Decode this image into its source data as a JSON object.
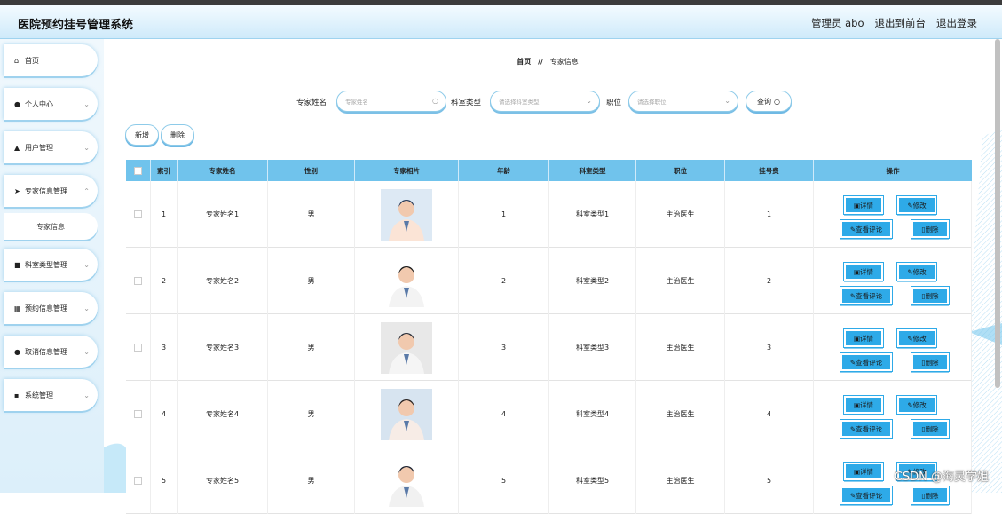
{
  "header": {
    "title": "医院预约挂号管理系统",
    "admin_label": "管理员 abo",
    "to_front": "退出到前台",
    "logout": "退出登录"
  },
  "sidebar": {
    "items": [
      {
        "label": "首页",
        "icon": "home-icon"
      },
      {
        "label": "个人中心",
        "icon": "user-icon"
      },
      {
        "label": "用户管理",
        "icon": "thumb-icon"
      },
      {
        "label": "专家信息管理",
        "icon": "send-icon"
      },
      {
        "label": "专家信息",
        "icon": ""
      },
      {
        "label": "科室类型管理",
        "icon": "monitor-icon"
      },
      {
        "label": "预约信息管理",
        "icon": "grid-icon"
      },
      {
        "label": "取消信息管理",
        "icon": "pin-icon"
      },
      {
        "label": "系统管理",
        "icon": "apps-icon"
      }
    ]
  },
  "breadcrumb": {
    "home": "首页",
    "sep": "//",
    "current": "专家信息"
  },
  "search": {
    "name_label": "专家姓名",
    "name_placeholder": "专家姓名",
    "dept_label": "科室类型",
    "dept_placeholder": "请选择科室类型",
    "pos_label": "职位",
    "pos_placeholder": "请选择职位",
    "query_button": "查询"
  },
  "toolbar": {
    "add_label": "新增",
    "delete_label": "删除"
  },
  "table": {
    "headers": [
      "",
      "索引",
      "专家姓名",
      "性别",
      "专家相片",
      "年龄",
      "科室类型",
      "职位",
      "挂号费",
      "操作"
    ],
    "rows": [
      {
        "index": "1",
        "name": "专家姓名1",
        "gender": "男",
        "age": "1",
        "dept": "科室类型1",
        "position": "主治医生",
        "fee": "1"
      },
      {
        "index": "2",
        "name": "专家姓名2",
        "gender": "男",
        "age": "2",
        "dept": "科室类型2",
        "position": "主治医生",
        "fee": "2"
      },
      {
        "index": "3",
        "name": "专家姓名3",
        "gender": "男",
        "age": "3",
        "dept": "科室类型3",
        "position": "主治医生",
        "fee": "3"
      },
      {
        "index": "4",
        "name": "专家姓名4",
        "gender": "男",
        "age": "4",
        "dept": "科室类型4",
        "position": "主治医生",
        "fee": "4"
      },
      {
        "index": "5",
        "name": "专家姓名5",
        "gender": "男",
        "age": "5",
        "dept": "科室类型5",
        "position": "主治医生",
        "fee": "5"
      }
    ],
    "actions": {
      "detail": "详情",
      "edit": "修改",
      "comments": "查看评论",
      "delete": "删除"
    }
  },
  "watermark": "CSDN @海灵学姐",
  "colors": {
    "accent": "#2eaae8",
    "header_bg": "#70c3ec",
    "border": "#8ecbe9"
  }
}
